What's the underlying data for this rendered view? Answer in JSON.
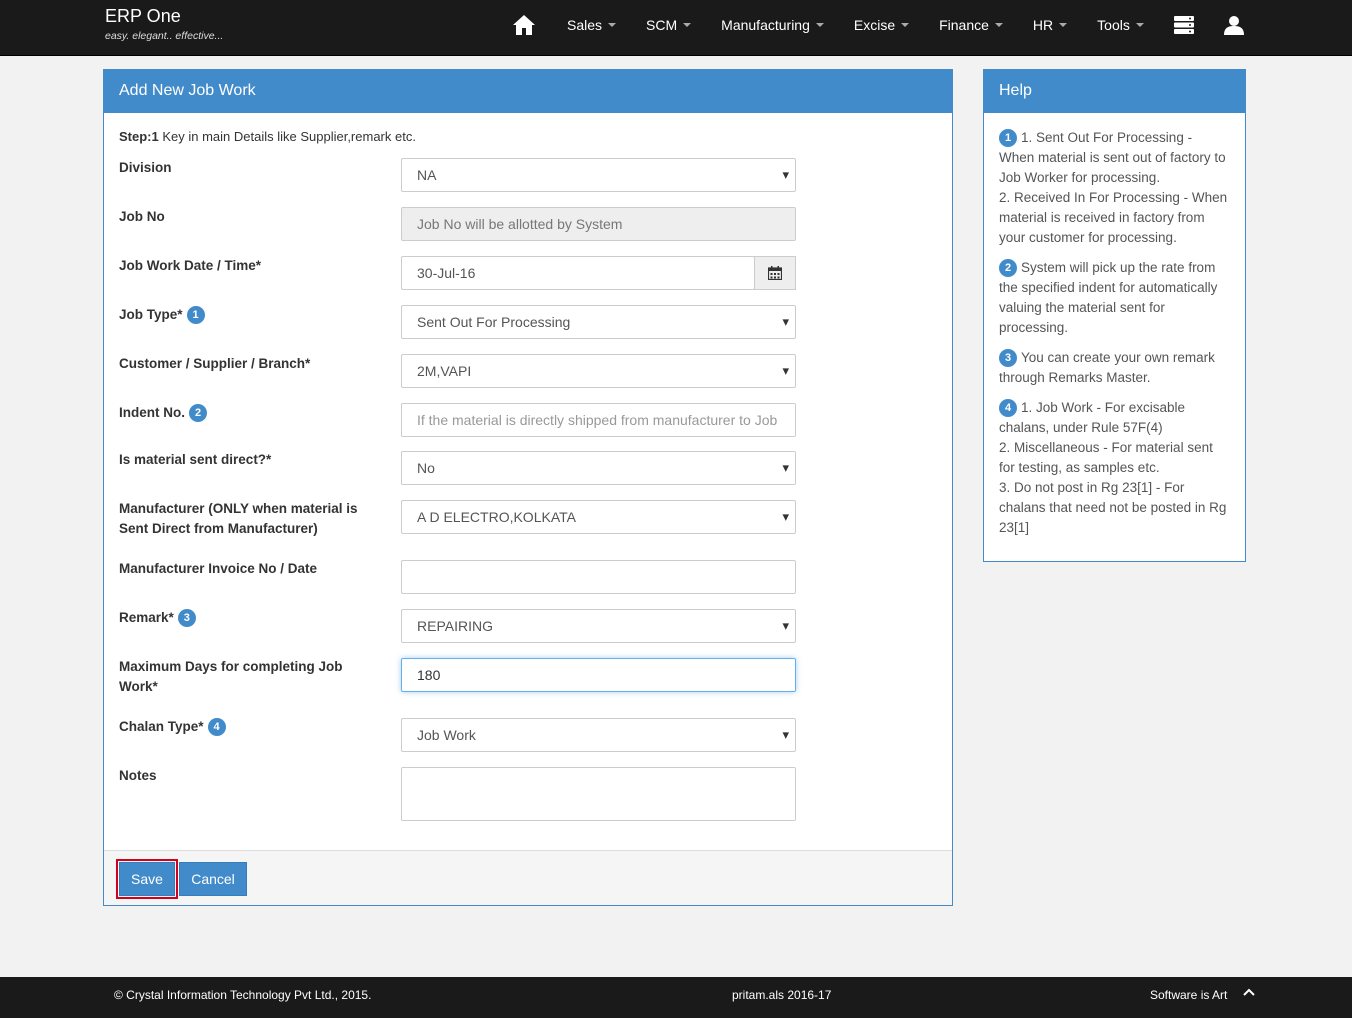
{
  "app": {
    "title": "ERP One",
    "tagline": "easy. elegant.. effective..."
  },
  "nav": {
    "items": [
      "Sales",
      "SCM",
      "Manufacturing",
      "Excise",
      "Finance",
      "HR",
      "Tools"
    ]
  },
  "form": {
    "heading": "Add New Job Work",
    "step_bold": "Step:1",
    "step_text": " Key in main Details like Supplier,remark etc.",
    "division_label": "Division",
    "division_value": "NA",
    "jobno_label": "Job No",
    "jobno_placeholder": "Job No will be allotted by System",
    "date_label": "Job Work Date / Time*",
    "date_value": "30-Jul-16",
    "jobtype_label": "Job Type*",
    "jobtype_badge": "1",
    "jobtype_value": "Sent Out For Processing",
    "customer_label": "Customer / Supplier / Branch*",
    "customer_value": "2M,VAPI",
    "indent_label": "Indent No.",
    "indent_badge": "2",
    "indent_placeholder": "If the material is directly shipped from manufacturer to Job",
    "direct_label": "Is material sent direct?*",
    "direct_value": "No",
    "manufacturer_label_1": "Manufacturer (ONLY when material is",
    "manufacturer_label_2": "Sent Direct from Manufacturer)",
    "manufacturer_value": "A D ELECTRO,KOLKATA",
    "mfg_invoice_label": "Manufacturer Invoice No / Date",
    "mfg_invoice_value": "",
    "remark_label": "Remark*",
    "remark_badge": "3",
    "remark_value": "REPAIRING",
    "maxdays_label_1": "Maximum Days for completing Job",
    "maxdays_label_2": "Work*",
    "maxdays_value": "180",
    "chalan_label": "Chalan Type*",
    "chalan_badge": "4",
    "chalan_value": "Job Work",
    "notes_label": "Notes",
    "notes_value": "",
    "save_label": "Save",
    "cancel_label": "Cancel"
  },
  "help": {
    "heading": "Help",
    "items": [
      {
        "badge": "1",
        "lines": [
          "1. Sent Out For Processing - When material is sent out of factory to Job Worker for processing.",
          "2. Received In For Processing - When material is received in factory from your customer for processing."
        ]
      },
      {
        "badge": "2",
        "lines": [
          "System will pick up the rate from the specified indent for automatically valuing the material sent for processing."
        ]
      },
      {
        "badge": "3",
        "lines": [
          "You can create your own remark through Remarks Master."
        ]
      },
      {
        "badge": "4",
        "lines": [
          "1. Job Work - For excisable chalans, under Rule 57F(4)",
          "2. Miscellaneous - For material sent for testing, as samples etc.",
          "3. Do not post in Rg 23[1] - For chalans that need not be posted in Rg 23[1]"
        ]
      }
    ]
  },
  "footer": {
    "copyright": "© Crystal Information Technology Pvt Ltd., 2015.",
    "user": "pritam.als 2016-17",
    "slogan": "Software is Art"
  }
}
